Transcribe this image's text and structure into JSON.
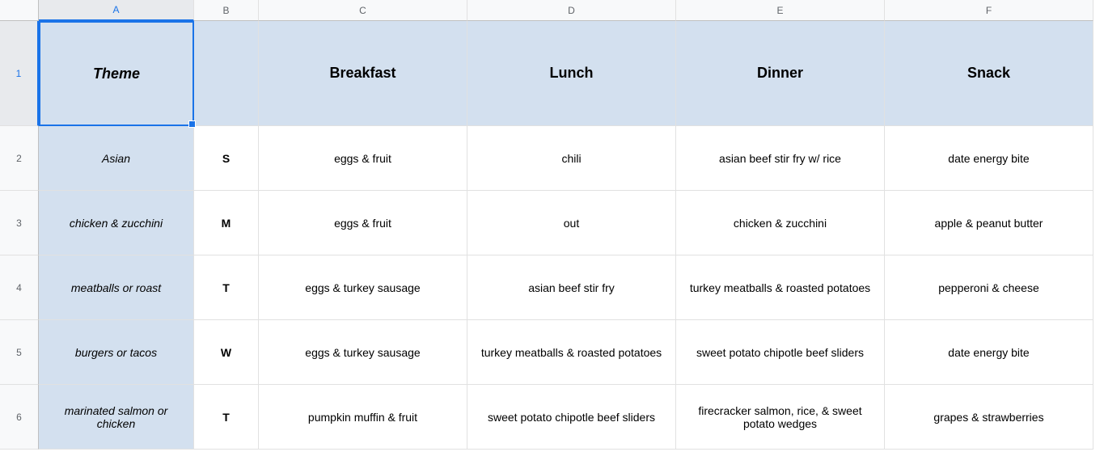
{
  "columns": [
    "A",
    "B",
    "C",
    "D",
    "E",
    "F"
  ],
  "rowNums": [
    "1",
    "2",
    "3",
    "4",
    "5",
    "6"
  ],
  "headers": {
    "theme": "Theme",
    "breakfast": "Breakfast",
    "lunch": "Lunch",
    "dinner": "Dinner",
    "snack": "Snack"
  },
  "rows": [
    {
      "theme": "Asian",
      "day": "S",
      "breakfast": "eggs & fruit",
      "lunch": "chili",
      "dinner": "asian beef stir fry w/ rice",
      "snack": "date energy bite"
    },
    {
      "theme": "chicken & zucchini",
      "day": "M",
      "breakfast": "eggs & fruit",
      "lunch": "out",
      "dinner": "chicken & zucchini",
      "snack": "apple & peanut butter"
    },
    {
      "theme": "meatballs or roast",
      "day": "T",
      "breakfast": "eggs & turkey sausage",
      "lunch": "asian beef stir fry",
      "dinner": "turkey meatballs & roasted potatoes",
      "snack": "pepperoni & cheese"
    },
    {
      "theme": "burgers or tacos",
      "day": "W",
      "breakfast": "eggs & turkey sausage",
      "lunch": "turkey meatballs & roasted potatoes",
      "dinner": "sweet potato chipotle beef sliders",
      "snack": "date energy bite"
    },
    {
      "theme": "marinated salmon or chicken",
      "day": "T",
      "breakfast": "pumpkin muffin & fruit",
      "lunch": "sweet potato chipotle beef sliders",
      "dinner": "firecracker salmon, rice, & sweet potato wedges",
      "snack": "grapes & strawberries"
    }
  ]
}
